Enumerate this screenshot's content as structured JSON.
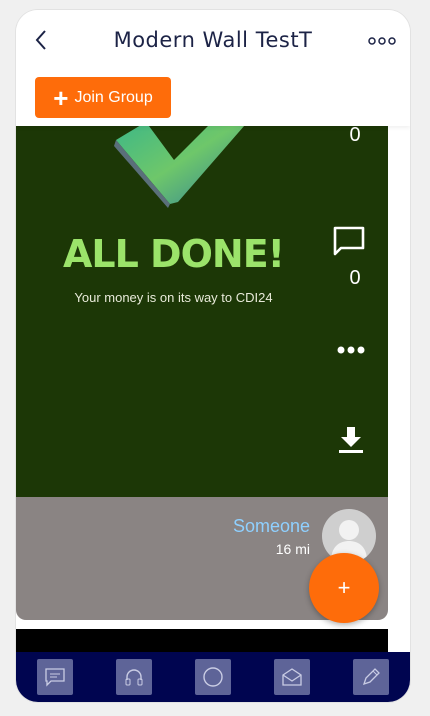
{
  "header": {
    "title": "Modern Wall TestT",
    "join_label": "Join Group"
  },
  "post": {
    "headline": "ALL DONE!",
    "subtitle": "Your money is on its way to CDI24",
    "like_count": "0",
    "comment_count": "0",
    "author": "Someone",
    "distance": "16 mi"
  },
  "fab_label": "+",
  "tabs": [
    "chat-icon",
    "headset-icon",
    "circle-icon",
    "mail-icon",
    "pen-icon"
  ],
  "colors": {
    "accent": "#fe6c0a",
    "tabbar": "#000550",
    "post_bg": "#1c3706",
    "headline": "#9be36a"
  }
}
